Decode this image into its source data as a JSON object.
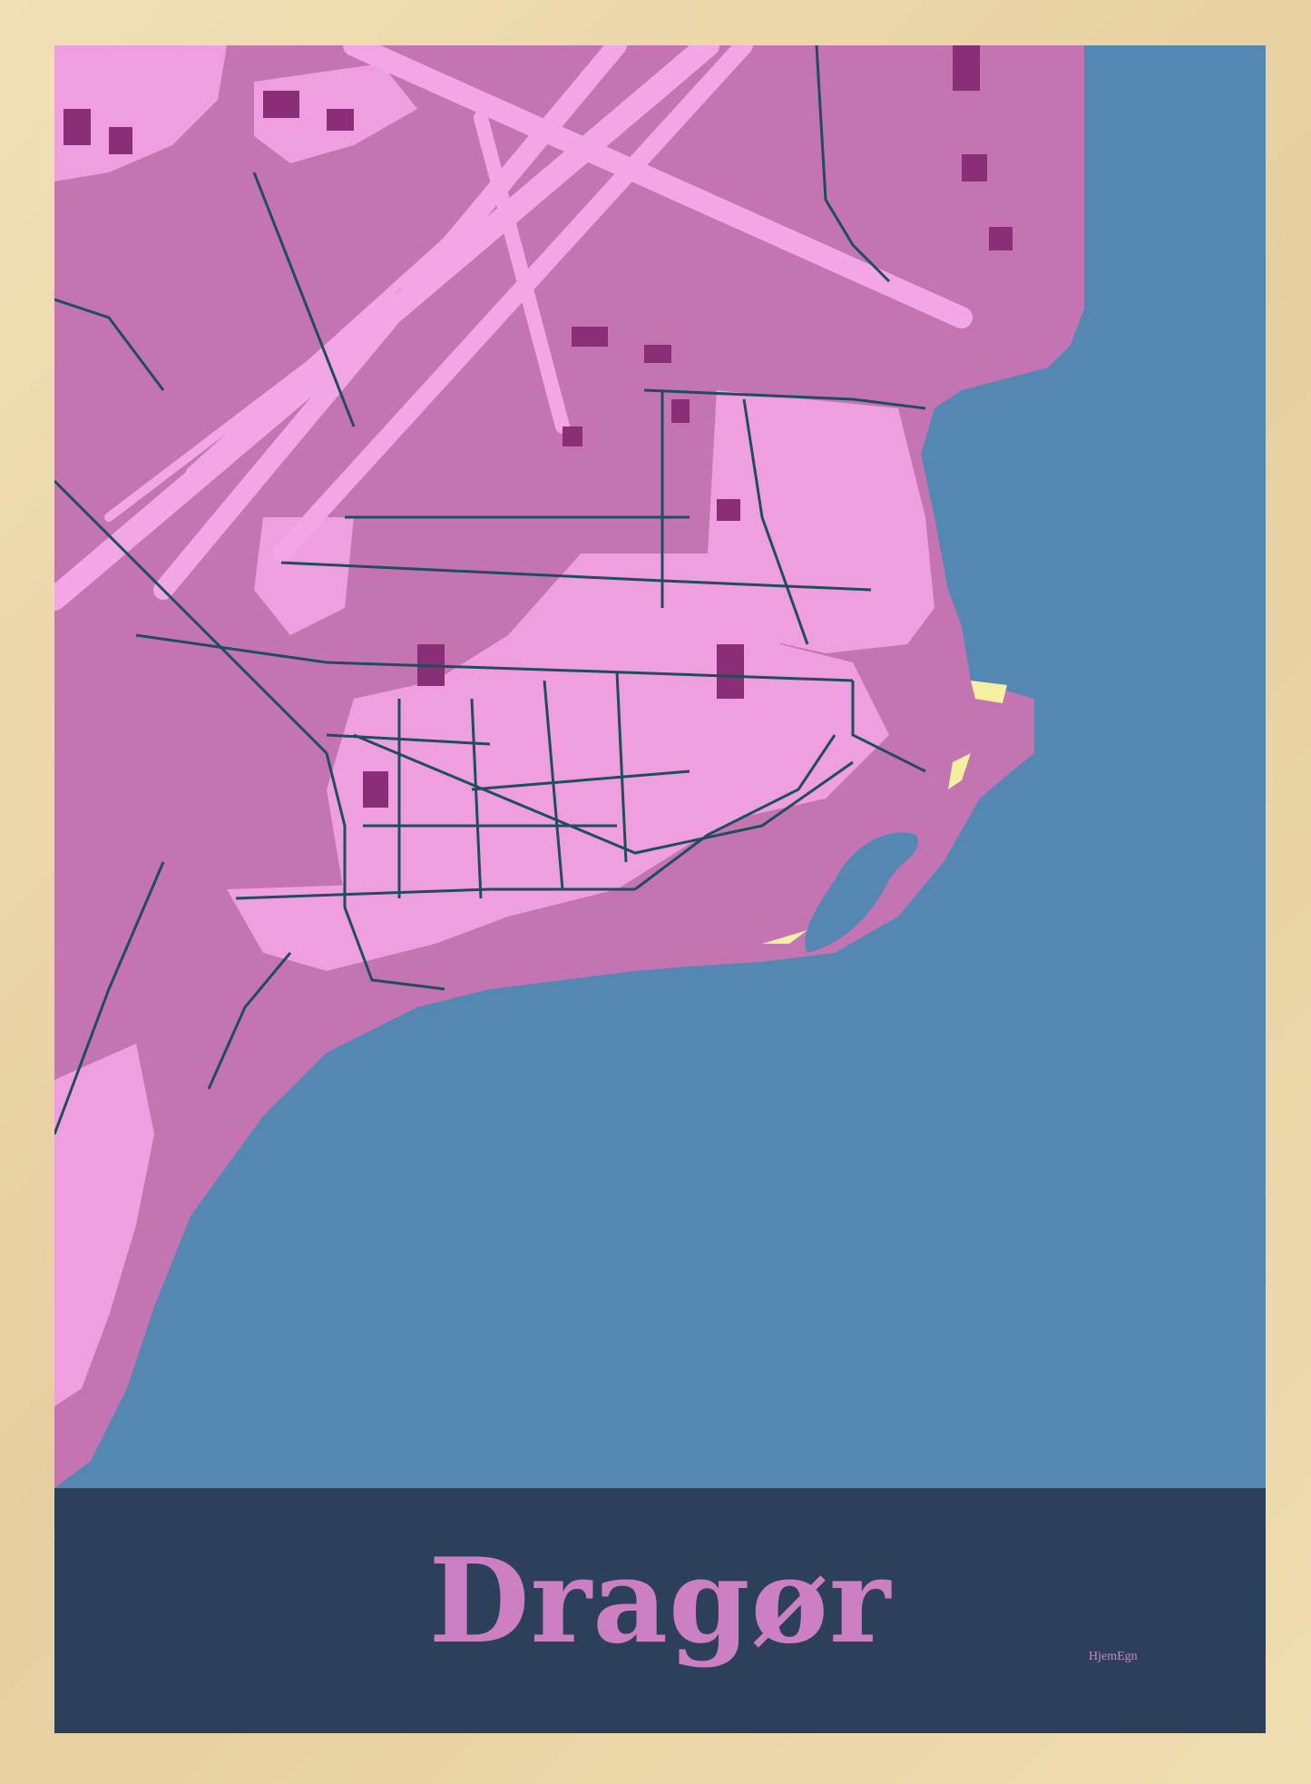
{
  "poster": {
    "city_name": "Dragør",
    "brand": "HjemEgn"
  },
  "colors": {
    "frame": "#e9d4a7",
    "water": "#5488b2",
    "land": "#c474b0",
    "urban": "#ef9fe0",
    "runway": "#f3a6e6",
    "roads": "#1e4e59",
    "buildings": "#8b2e78",
    "beach": "#f5f0a0",
    "band": "#2c4159",
    "title_text": "#cc80c3",
    "brand_text": "#c886c0"
  }
}
